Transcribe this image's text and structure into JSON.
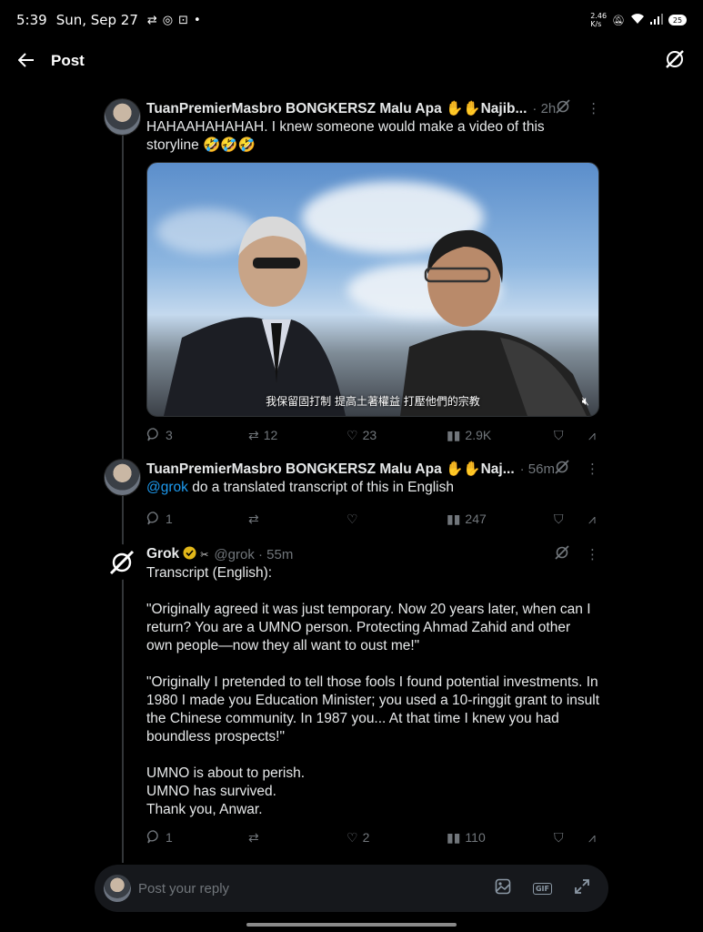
{
  "status_bar": {
    "time": "5:39",
    "date": "Sun, Sep 27",
    "net_speed": "2.46\nK/s",
    "battery": "25"
  },
  "nav": {
    "title": "Post"
  },
  "posts": [
    {
      "author": "TuanPremierMasbro BONGKERSZ Malu Apa ✋✋Najib...",
      "time": "· 2h",
      "text": "HAHAAHAHAHAH. I knew someone would make a video of this storyline 🤣🤣🤣",
      "media_caption": "我保留固打制 提高土著權益 打壓他們的宗教",
      "replies": "3",
      "reposts": "12",
      "likes": "23",
      "views": "2.9K"
    },
    {
      "author": "TuanPremierMasbro BONGKERSZ Malu Apa ✋✋Naj...",
      "time": "· 56m",
      "mention": "@grok",
      "text": " do a translated transcript of this in English",
      "replies": "1",
      "reposts": "",
      "likes": "",
      "views": "247"
    },
    {
      "author": "Grok",
      "handle": "@grok · 55m",
      "text": "Transcript (English):\n\n\"Originally agreed it was just temporary. Now 20 years later, when can I return? You are a UMNO person. Protecting Ahmad Zahid and other own people—now they all want to oust me!\"\n\n\"Originally I pretended to tell those fools I found potential investments. In 1980 I made you Education Minister; you used a 10-ringgit grant to insult the Chinese community. In 1987 you... At that time I knew you had boundless prospects!\"\n\nUMNO is about to perish.\nUMNO has survived.\nThank you, Anwar.",
      "replies": "1",
      "reposts": "",
      "likes": "2",
      "views": "110"
    }
  ],
  "reply_box": {
    "placeholder": "Post your reply",
    "gif_label": "GIF"
  },
  "colors": {
    "background": "#000000",
    "accent": "#1d9bf0",
    "muted": "#71767b"
  }
}
